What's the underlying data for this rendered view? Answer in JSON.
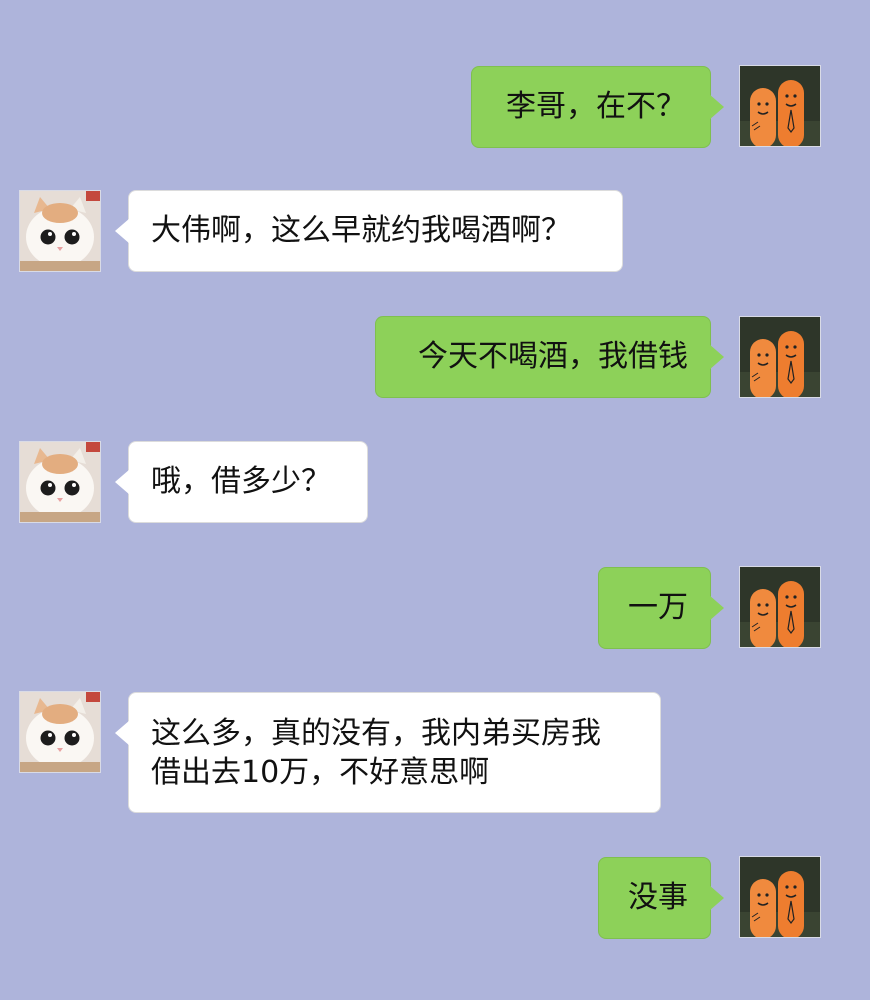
{
  "conversation": {
    "messages": [
      {
        "sender": "me",
        "text": "李哥，在不？"
      },
      {
        "sender": "them",
        "text": "大伟啊，这么早就约我喝酒啊？"
      },
      {
        "sender": "me",
        "text": "今天不喝酒，我借钱"
      },
      {
        "sender": "them",
        "text": "哦，借多少？"
      },
      {
        "sender": "me",
        "text": "一万"
      },
      {
        "sender": "them",
        "text": "这么多，真的没有，我内弟买房我\n借出去10万，不好意思啊"
      },
      {
        "sender": "me",
        "text": "没事"
      }
    ]
  },
  "avatars": {
    "me": {
      "icon": "finger-puppets-avatar-icon"
    },
    "them": {
      "icon": "white-cat-avatar-icon"
    }
  },
  "colors": {
    "background": "#aeb4db",
    "outgoing_bubble": "#8dd159",
    "incoming_bubble": "#ffffff"
  }
}
